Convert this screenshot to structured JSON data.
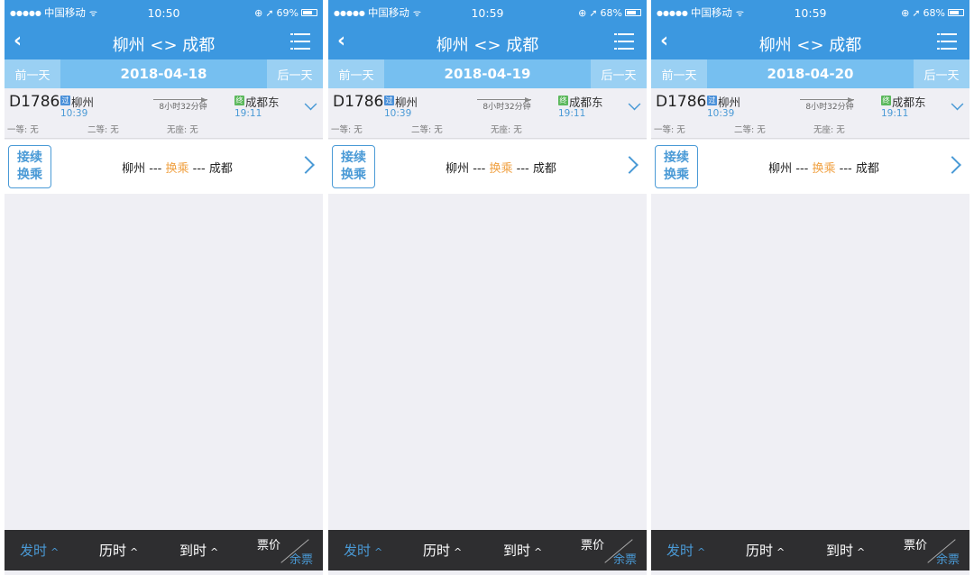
{
  "status": {
    "dots": "●●●●●",
    "carrier": "中国移动",
    "wifi": "ᯤ"
  },
  "nav": {
    "back": "‹",
    "title": "柳州 <> 成都"
  },
  "datebar": {
    "prev": "前一天",
    "next": "后一天"
  },
  "train": {
    "number": "D1786",
    "pass_tag": "过",
    "end_tag": "终",
    "from": "柳州",
    "from_time": "10:39",
    "duration": "8小时32分钟",
    "to": "成都东",
    "to_time": "19:11",
    "seat_first": "一等: 无",
    "seat_second": "二等: 无",
    "seat_none": "无座: 无"
  },
  "transfer": {
    "label_line1": "接续",
    "label_line2": "换乘",
    "route_from": "柳州",
    "route_mid": "换乘",
    "route_to": "成都",
    "sep": "---"
  },
  "tabs": {
    "depart": "发时",
    "duration": "历时",
    "arrive": "到时",
    "price": "票价",
    "remaining": "余票",
    "caret": "^"
  },
  "panels": [
    {
      "time": "10:50",
      "battery": "69%",
      "battery_level": 0.69,
      "date": "2018-04-18"
    },
    {
      "time": "10:59",
      "battery": "68%",
      "battery_level": 0.68,
      "date": "2018-04-19"
    },
    {
      "time": "10:59",
      "battery": "68%",
      "battery_level": 0.68,
      "date": "2018-04-20"
    }
  ],
  "colors": {
    "primary": "#3c98e0",
    "accent": "#4a9ad6",
    "orange": "#f0a040",
    "tabbar": "#2e2e30"
  }
}
